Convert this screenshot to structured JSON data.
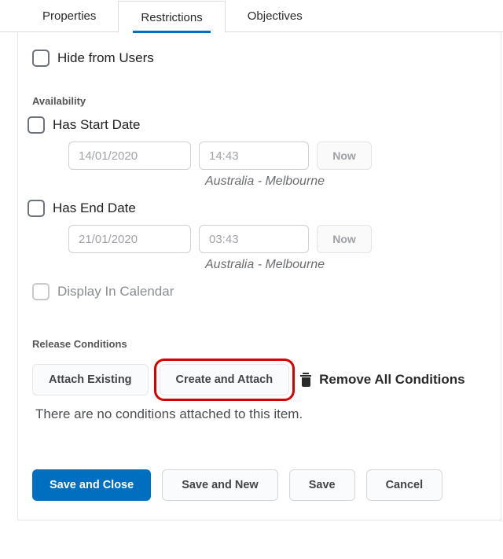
{
  "tabs": {
    "properties": "Properties",
    "restrictions": "Restrictions",
    "objectives": "Objectives"
  },
  "hide_from_users": "Hide from Users",
  "availability": {
    "title": "Availability",
    "has_start": "Has Start Date",
    "has_end": "Has End Date",
    "start_date": "14/01/2020",
    "start_time": "14:43",
    "end_date": "21/01/2020",
    "end_time": "03:43",
    "now": "Now",
    "timezone": "Australia - Melbourne",
    "display_in_calendar": "Display In Calendar"
  },
  "release": {
    "title": "Release Conditions",
    "attach_existing": "Attach Existing",
    "create_attach": "Create and Attach",
    "remove_all": "Remove All Conditions",
    "empty": "There are no conditions attached to this item."
  },
  "footer": {
    "save_close": "Save and Close",
    "save_new": "Save and New",
    "save": "Save",
    "cancel": "Cancel"
  }
}
